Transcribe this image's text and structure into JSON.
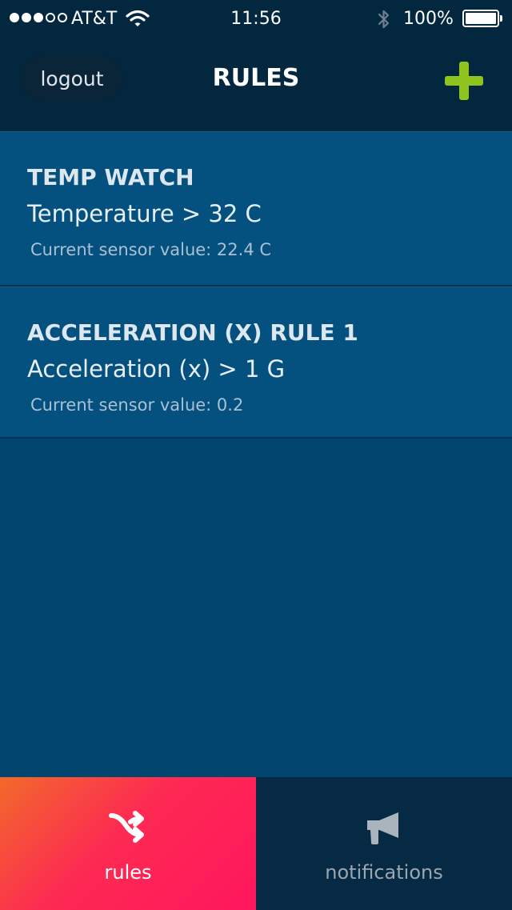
{
  "status_bar": {
    "carrier": "AT&T",
    "time": "11:56",
    "battery_percent": "100%",
    "signal_bars_filled": 3,
    "signal_bars_total": 5
  },
  "nav": {
    "logout_label": "logout",
    "title": "RULES",
    "add_icon": "plus-icon",
    "accent_color": "#8fc41f"
  },
  "rules": [
    {
      "name": "TEMP WATCH",
      "condition": "Temperature > 32 C",
      "sensor_value": "Current sensor value: 22.4 C"
    },
    {
      "name": "ACCELERATION (X) RULE 1",
      "condition": "Acceleration (x) > 1 G",
      "sensor_value": "Current sensor value: 0.2"
    }
  ],
  "tabs": [
    {
      "label": "rules",
      "icon": "shuffle-icon",
      "active": true
    },
    {
      "label": "notifications",
      "icon": "megaphone-icon",
      "active": false
    }
  ],
  "colors": {
    "header_bg": "#042740",
    "list_bg": "#02456e",
    "active_tab_gradient_start": "#f26a2a",
    "active_tab_gradient_end": "#ff165e",
    "inactive_tab_bg": "#062a43"
  }
}
